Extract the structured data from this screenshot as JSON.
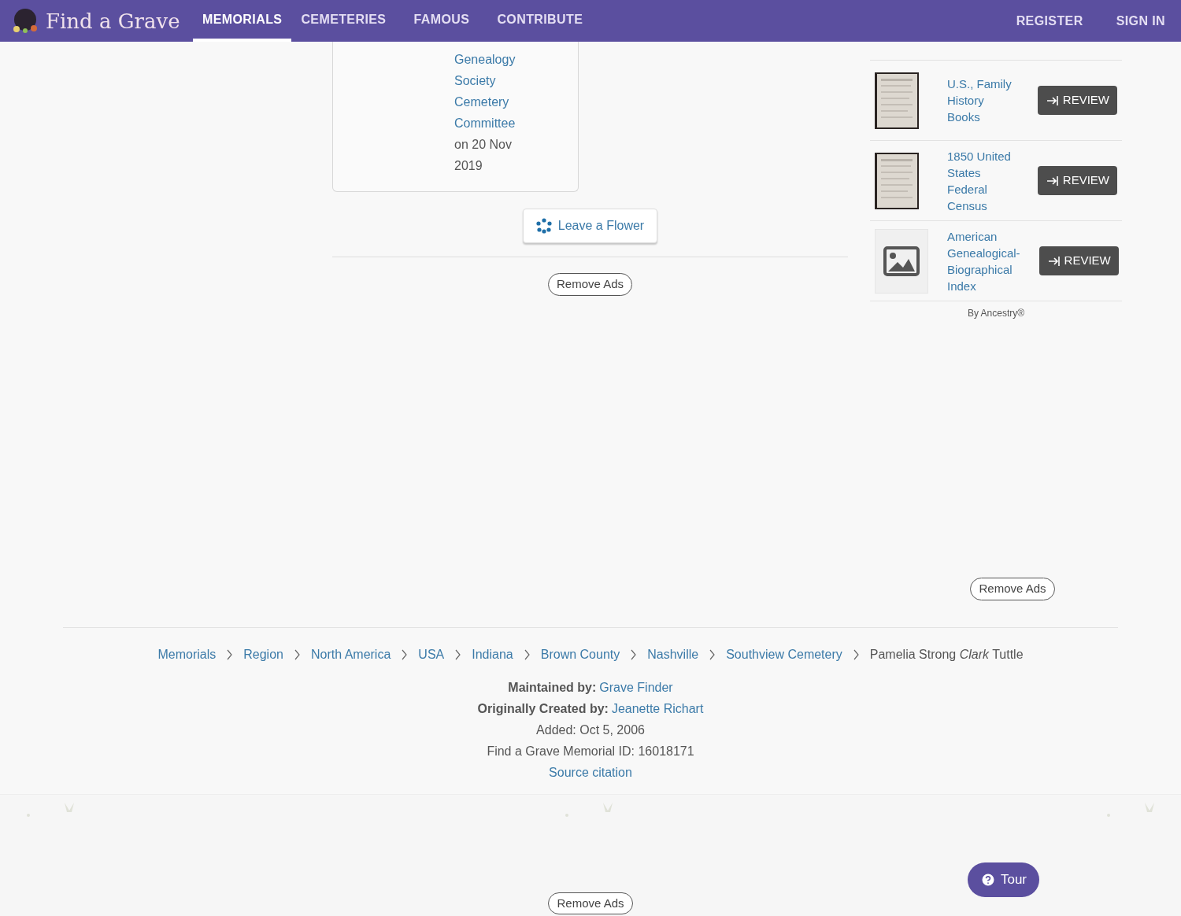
{
  "header": {
    "logo": "Find a Grave",
    "nav": [
      {
        "label": "MEMORIALS",
        "selected": true
      },
      {
        "label": "CEMETERIES",
        "selected": false
      },
      {
        "label": "FAMOUS",
        "selected": false
      },
      {
        "label": "CONTRIBUTE",
        "selected": false
      }
    ],
    "account": [
      "REGISTER",
      "SIGN IN"
    ]
  },
  "contributor_card": {
    "link": "Genealogy Society Cemetery Committee",
    "date": "on 20 Nov 2019"
  },
  "leave_flower": "Leave a Flower",
  "remove_ads": [
    "Remove Ads",
    "Remove Ads",
    "Remove Ads"
  ],
  "records": [
    {
      "title": "U.S., Family History Books",
      "kind": "picture",
      "button": "REVIEW"
    },
    {
      "title": "1850 United States Federal Census",
      "kind": "picture",
      "button": "REVIEW"
    },
    {
      "title": "American Genealogical-Biographical Index",
      "kind": "placeholder",
      "button": "REVIEW"
    }
  ],
  "records_credit": "By Ancestry®",
  "breadcrumbs": [
    "Memorials",
    "Region",
    "North America",
    "USA",
    "Indiana",
    "Brown County",
    "Nashville",
    "Southview Cemetery",
    "Pamelia Strong *Clark* Tuttle"
  ],
  "footer": {
    "maintained_label": "Maintained by:",
    "maintained_by": "Grave Finder",
    "created_label": "Originally Created by:",
    "created_by": "Jeanette Richart",
    "added": "Added: Oct 5, 2006",
    "memorial_id": "Find a Grave Memorial ID: 16018171",
    "citation": "Source citation"
  },
  "tour": "Tour"
}
